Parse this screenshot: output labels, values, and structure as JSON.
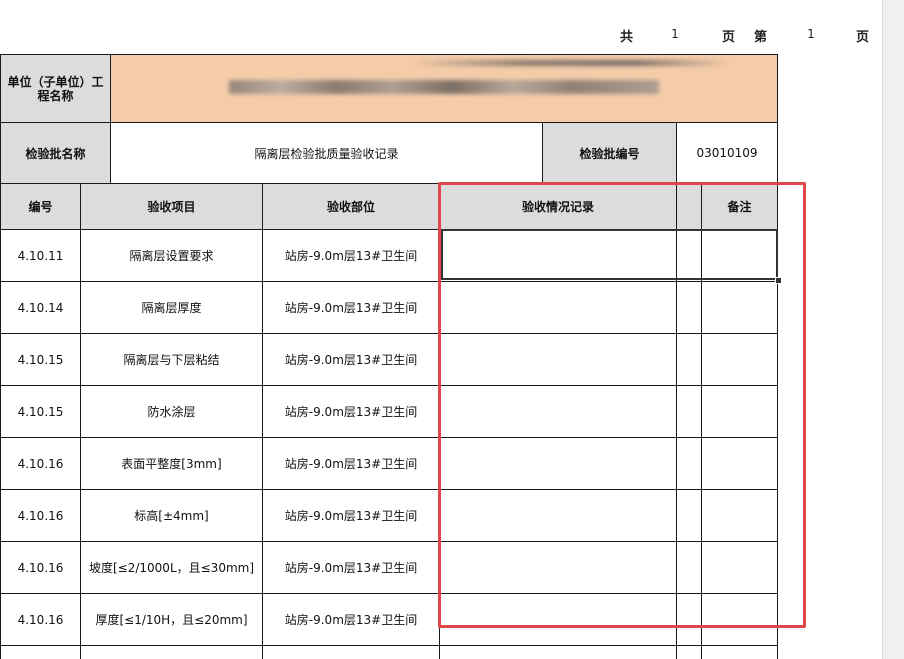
{
  "pager": {
    "total_label": "共",
    "total_pages": "1",
    "page_label": "页",
    "current_label": "第",
    "current_page": "1",
    "page_suffix": "页"
  },
  "header": {
    "unit_label": "单位（子单位）工程名称",
    "batch_name_label": "检验批名称",
    "batch_name_value": "隔离层检验批质量验收记录",
    "batch_no_label": "检验批编号",
    "batch_no_value": "03010109"
  },
  "columns": {
    "no": "编号",
    "item": "验收项目",
    "location": "验收部位",
    "record": "验收情况记录",
    "remark": "备注"
  },
  "rows": [
    {
      "no": "4.10.11",
      "item": "隔离层设置要求",
      "location": "站房-9.0m层13#卫生间",
      "record": "",
      "remark": ""
    },
    {
      "no": "4.10.14",
      "item": "隔离层厚度",
      "location": "站房-9.0m层13#卫生间",
      "record": "",
      "remark": ""
    },
    {
      "no": "4.10.15",
      "item": "隔离层与下层粘结",
      "location": "站房-9.0m层13#卫生间",
      "record": "",
      "remark": ""
    },
    {
      "no": "4.10.15",
      "item": "防水涂层",
      "location": "站房-9.0m层13#卫生间",
      "record": "",
      "remark": ""
    },
    {
      "no": "4.10.16",
      "item": "表面平整度[3mm]",
      "location": "站房-9.0m层13#卫生间",
      "record": "",
      "remark": ""
    },
    {
      "no": "4.10.16",
      "item": "标高[±4mm]",
      "location": "站房-9.0m层13#卫生间",
      "record": "",
      "remark": ""
    },
    {
      "no": "4.10.16",
      "item": "坡度[≤2/1000L，且≤30mm]",
      "location": "站房-9.0m层13#卫生间",
      "record": "",
      "remark": ""
    },
    {
      "no": "4.10.16",
      "item": "厚度[≤1/10H，且≤20mm]",
      "location": "站房-9.0m层13#卫生间",
      "record": "",
      "remark": ""
    }
  ]
}
